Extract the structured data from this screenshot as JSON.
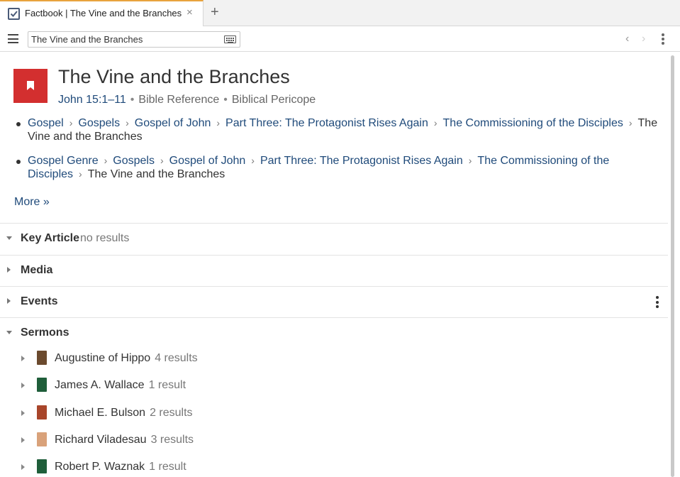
{
  "tab": {
    "title": "Factbook | The Vine and the Branches",
    "icon": "checkbox-icon",
    "close": "×",
    "new": "+"
  },
  "toolbar": {
    "search_value": "The Vine and the Branches",
    "keyboard_icon": "keyboard-icon",
    "back": "‹",
    "forward": "›"
  },
  "header": {
    "title": "The Vine and the Branches",
    "reference": "John 15:1–11",
    "type1": "Bible Reference",
    "type2": "Biblical Pericope",
    "icon_color": "#d32f2f"
  },
  "breadcrumbs": [
    {
      "links": [
        "Gospel",
        "Gospels",
        "Gospel of John",
        "Part Three: The Protagonist Rises Again",
        "The Commissioning of the Disciples"
      ],
      "last": "The Vine and the Branches"
    },
    {
      "links": [
        "Gospel Genre",
        "Gospels",
        "Gospel of John",
        "Part Three: The Protagonist Rises Again",
        "The Commissioning of the Disciples"
      ],
      "last": "The Vine and the Branches"
    }
  ],
  "more_link": "More »",
  "sections": {
    "key_article": {
      "label": "Key Article",
      "status": "no results"
    },
    "media": {
      "label": "Media"
    },
    "events": {
      "label": "Events"
    },
    "sermons": {
      "label": "Sermons"
    }
  },
  "sermons": [
    {
      "name": "Augustine of Hippo",
      "count": "4 results",
      "color": "#6b4a2e"
    },
    {
      "name": "James A. Wallace",
      "count": "1 result",
      "color": "#1f5e3a"
    },
    {
      "name": "Michael E. Bulson",
      "count": "2 results",
      "color": "#a8452a"
    },
    {
      "name": "Richard Viladesau",
      "count": "3 results",
      "color": "#d9a27a"
    },
    {
      "name": "Robert P. Waznak",
      "count": "1 result",
      "color": "#1f5e3a"
    }
  ]
}
